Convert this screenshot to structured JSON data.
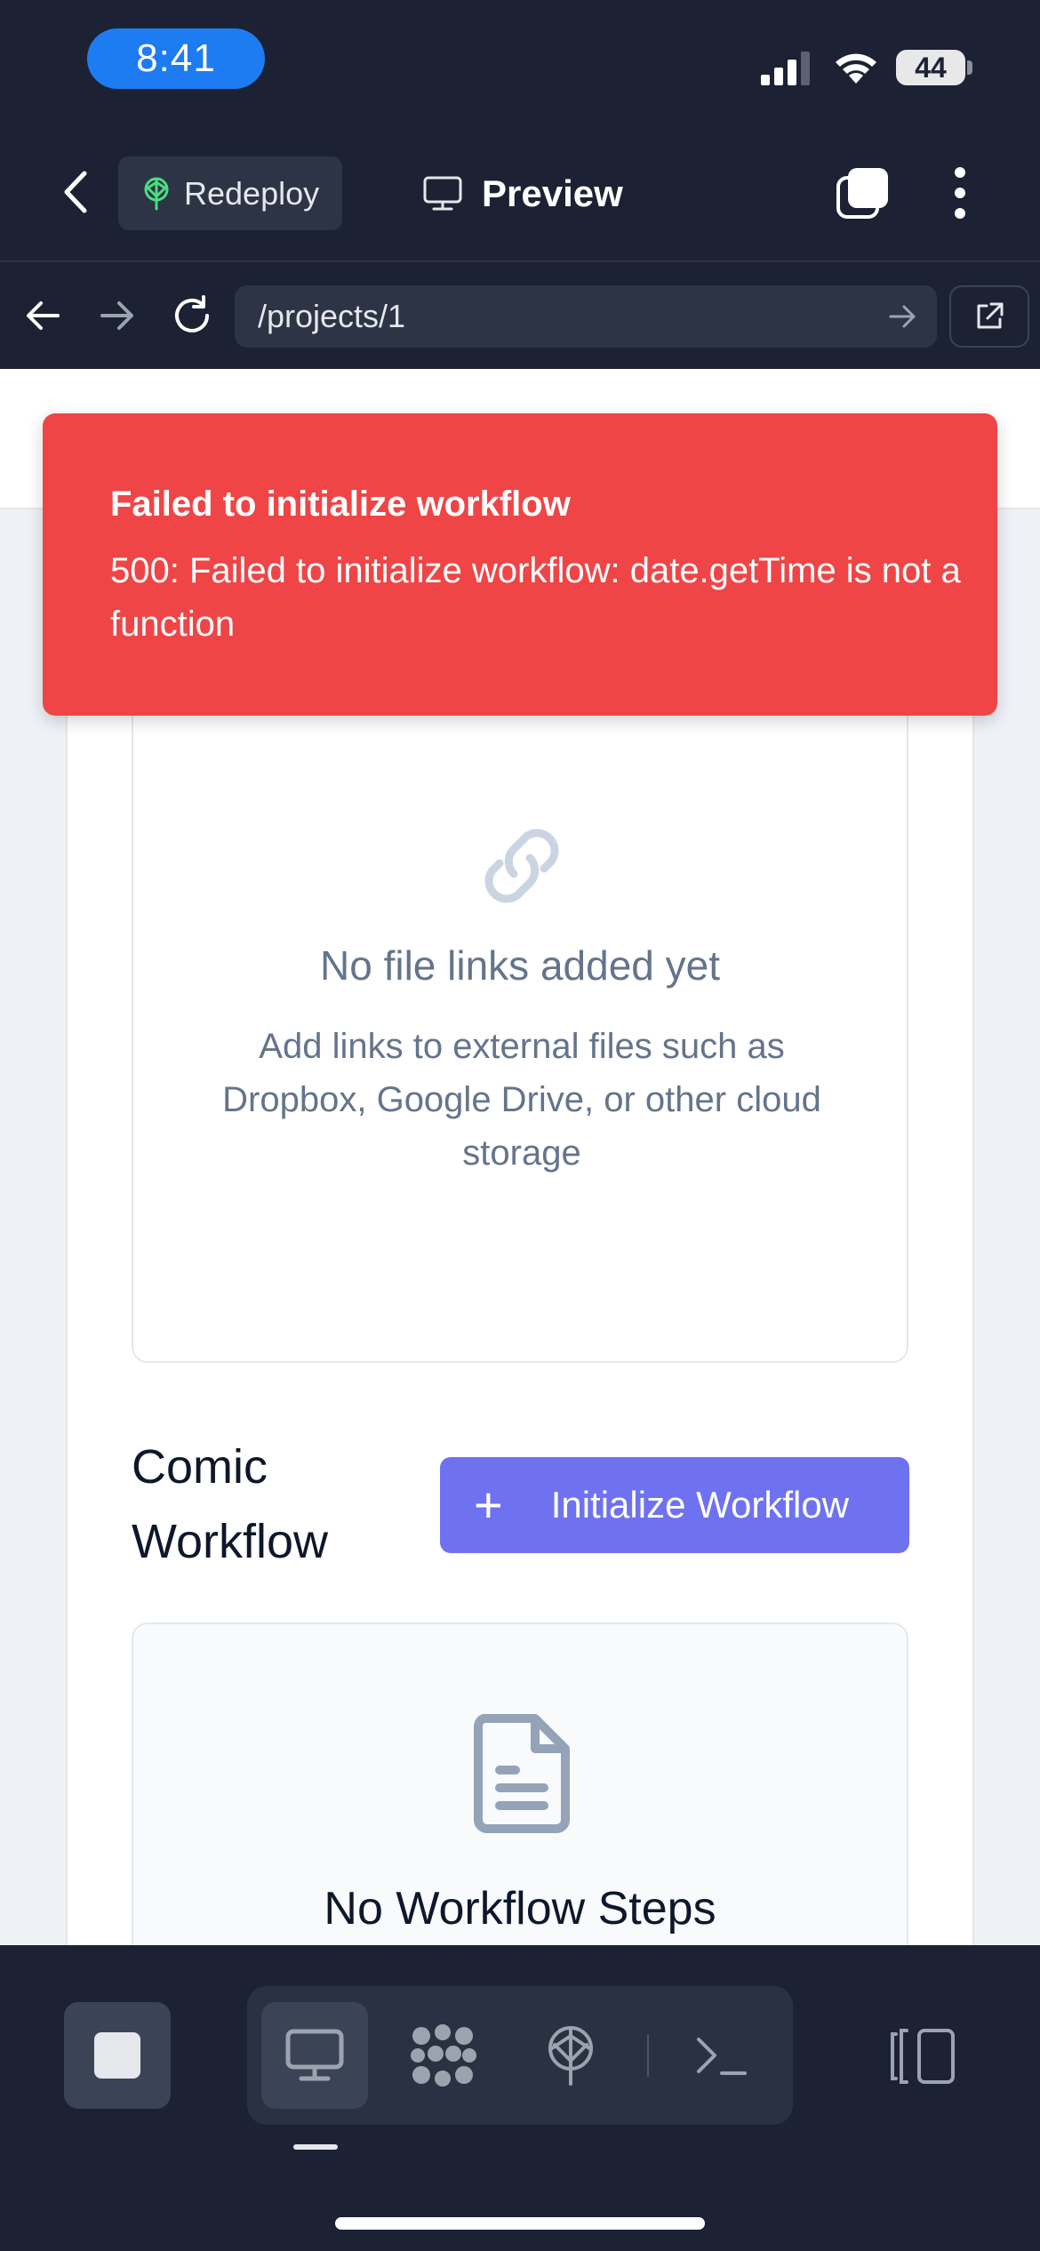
{
  "status_bar": {
    "time": "8:41",
    "battery": "44"
  },
  "app_bar": {
    "redeploy_label": "Redeploy",
    "preview_label": "Preview"
  },
  "browser": {
    "url": "/projects/1"
  },
  "toast": {
    "title": "Failed to initialize workflow",
    "message": "500: Failed to initialize workflow: date.getTime is not a function",
    "color": "#ef4546"
  },
  "file_links": {
    "empty_title": "No file links added yet",
    "empty_description": "Add links to external files such as Dropbox, Google Drive, or other cloud storage"
  },
  "workflow": {
    "section_title": "Comic Workflow",
    "init_button_label": "Initialize Workflow",
    "empty_title": "No Workflow Steps",
    "accent_color": "#6e72f0"
  },
  "bottom_toolbar": {
    "items": [
      "stop-icon",
      "desktop-icon",
      "nodes-icon",
      "deploy-icon",
      "terminal-icon",
      "panel-toggle-icon"
    ],
    "active": "desktop-icon"
  }
}
